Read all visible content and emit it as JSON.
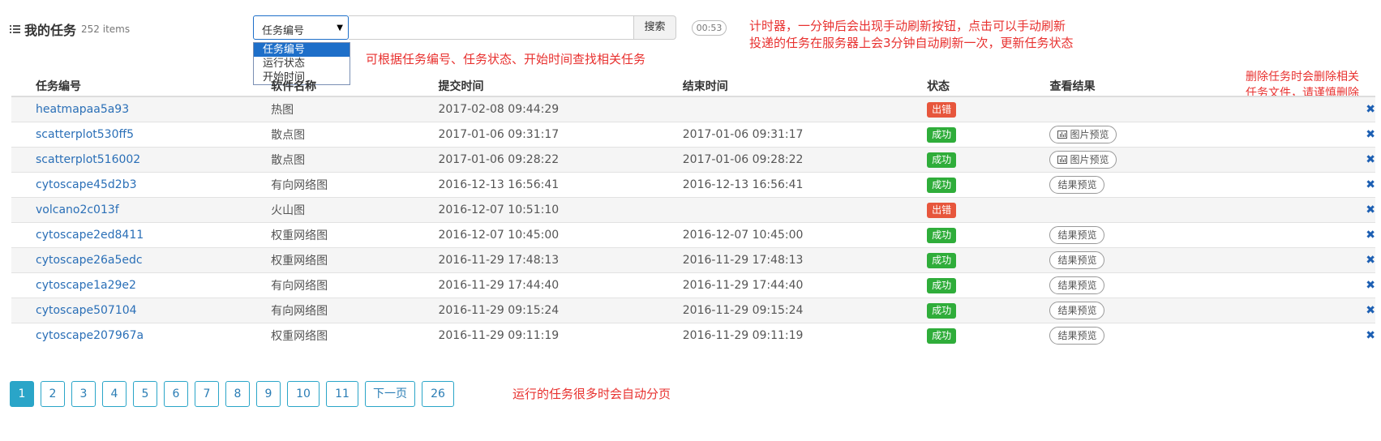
{
  "header": {
    "title": "我的任务",
    "count": "252 items"
  },
  "search": {
    "field_selected": "任务编号",
    "field_options": [
      "任务编号",
      "运行状态",
      "开始时间"
    ],
    "button_label": "搜索",
    "timer": "00:53"
  },
  "notes": {
    "timer_note_line1": "计时器，一分钟后会出现手动刷新按钮，点击可以手动刷新",
    "timer_note_line2": "投递的任务在服务器上会3分钟自动刷新一次，更新任务状态",
    "search_note": "可根据任务编号、任务状态、开始时间查找相关任务",
    "delete_note_line1": "删除任务时会删除相关",
    "delete_note_line2": "任务文件，请谨慎删除",
    "pager_note": "运行的任务很多时会自动分页"
  },
  "table": {
    "columns": [
      "任务编号",
      "软件名称",
      "提交时间",
      "结束时间",
      "状态",
      "查看结果"
    ],
    "rows": [
      {
        "id": "heatmapaa5a93",
        "software": "热图",
        "submitted": "2017-02-08 09:44:29",
        "finished": "",
        "status": "出错",
        "status_type": "err",
        "result": ""
      },
      {
        "id": "scatterplot530ff5",
        "software": "散点图",
        "submitted": "2017-01-06 09:31:17",
        "finished": "2017-01-06 09:31:17",
        "status": "成功",
        "status_type": "ok",
        "result": "图片预览",
        "result_icon": "chart-icon"
      },
      {
        "id": "scatterplot516002",
        "software": "散点图",
        "submitted": "2017-01-06 09:28:22",
        "finished": "2017-01-06 09:28:22",
        "status": "成功",
        "status_type": "ok",
        "result": "图片预览",
        "result_icon": "chart-icon"
      },
      {
        "id": "cytoscape45d2b3",
        "software": "有向网络图",
        "submitted": "2016-12-13 16:56:41",
        "finished": "2016-12-13 16:56:41",
        "status": "成功",
        "status_type": "ok",
        "result": "结果预览"
      },
      {
        "id": "volcano2c013f",
        "software": "火山图",
        "submitted": "2016-12-07 10:51:10",
        "finished": "",
        "status": "出错",
        "status_type": "err",
        "result": ""
      },
      {
        "id": "cytoscape2ed8411",
        "software": "权重网络图",
        "submitted": "2016-12-07 10:45:00",
        "finished": "2016-12-07 10:45:00",
        "status": "成功",
        "status_type": "ok",
        "result": "结果预览"
      },
      {
        "id": "cytoscape26a5edc",
        "software": "权重网络图",
        "submitted": "2016-11-29 17:48:13",
        "finished": "2016-11-29 17:48:13",
        "status": "成功",
        "status_type": "ok",
        "result": "结果预览"
      },
      {
        "id": "cytoscape1a29e2",
        "software": "有向网络图",
        "submitted": "2016-11-29 17:44:40",
        "finished": "2016-11-29 17:44:40",
        "status": "成功",
        "status_type": "ok",
        "result": "结果预览"
      },
      {
        "id": "cytoscape507104",
        "software": "有向网络图",
        "submitted": "2016-11-29 09:15:24",
        "finished": "2016-11-29 09:15:24",
        "status": "成功",
        "status_type": "ok",
        "result": "结果预览"
      },
      {
        "id": "cytoscape207967a",
        "software": "权重网络图",
        "submitted": "2016-11-29 09:11:19",
        "finished": "2016-11-29 09:11:19",
        "status": "成功",
        "status_type": "ok",
        "result": "结果预览"
      }
    ],
    "delete_glyph": "✖"
  },
  "pagination": {
    "pages": [
      "1",
      "2",
      "3",
      "4",
      "5",
      "6",
      "7",
      "8",
      "9",
      "10",
      "11"
    ],
    "active": "1",
    "next_label": "下一页",
    "last": "26"
  },
  "colors": {
    "accent": "#2aa5c8",
    "link": "#2a6fb7",
    "success": "#2fad3a",
    "error": "#e7563c",
    "note": "#e8312f"
  }
}
